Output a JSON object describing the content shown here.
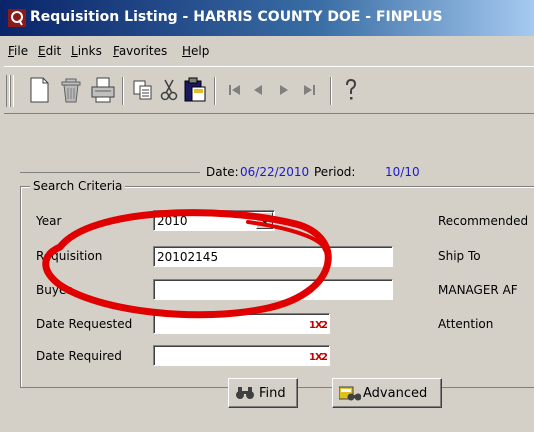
{
  "window": {
    "title": "Requisition Listing - HARRIS COUNTY DOE - FINPLUS"
  },
  "menu": [
    "File",
    "Edit",
    "Links",
    "Favorites",
    "Help"
  ],
  "header": {
    "date_label": "Date:",
    "date_value": "06/22/2010",
    "period_label": "Period:",
    "period_value": "10/10"
  },
  "search": {
    "group_title": "Search Criteria",
    "year_label": "Year",
    "year_value": "2010",
    "requisition_label": "Requisition",
    "requisition_value": "20102145",
    "buyer_label": "Buyer",
    "buyer_value": "",
    "date_requested_label": "Date Requested",
    "date_requested_value": "",
    "date_required_label": "Date Required",
    "date_required_value": "",
    "find_label": "Find",
    "advanced_label": "Advanced"
  },
  "right_panel": {
    "recommended_label": "Recommended",
    "ship_to_label": "Ship To",
    "ship_to_value": "MANAGER AF",
    "attention_label": "Attention"
  },
  "icons": {
    "toolbar": [
      "new-icon",
      "delete-icon",
      "print-icon",
      "copy-icon",
      "cut-icon",
      "paste-icon",
      "first-record-icon",
      "previous-record-icon",
      "next-record-icon",
      "last-record-icon",
      "help-icon"
    ],
    "calendar": "calendar-icon",
    "find": "binoculars-icon",
    "advanced": "advanced-search-icon"
  },
  "colors": {
    "title_bar": "#0a246a",
    "info_text": "#1a1acc",
    "annotation": "#e00000",
    "face": "#d4d0c8"
  }
}
